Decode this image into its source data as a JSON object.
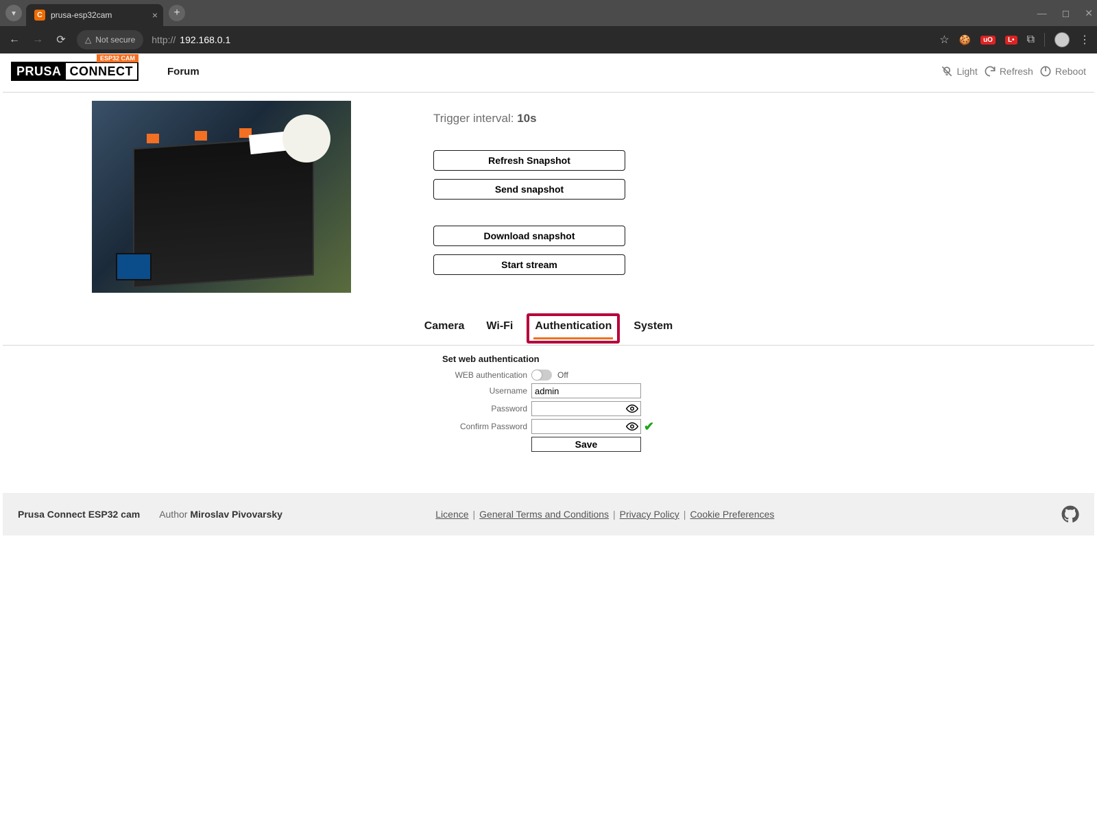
{
  "browser": {
    "tab_title": "prusa-esp32cam",
    "not_secure": "Not secure",
    "url_prefix": "http://",
    "url_ip": "192.168.0.1"
  },
  "header": {
    "logo_prusa": "PRUSA",
    "logo_connect": "CONNECT",
    "logo_tag": "ESP32 CAM",
    "forum": "Forum",
    "light": "Light",
    "refresh": "Refresh",
    "reboot": "Reboot"
  },
  "snapshot": {
    "trigger_label": "Trigger interval: ",
    "trigger_value": "10s",
    "refresh_btn": "Refresh Snapshot",
    "send_btn": "Send snapshot",
    "download_btn": "Download snapshot",
    "stream_btn": "Start stream"
  },
  "tabs": {
    "camera": "Camera",
    "wifi": "Wi-Fi",
    "auth": "Authentication",
    "system": "System"
  },
  "auth_form": {
    "title": "Set web authentication",
    "web_auth_label": "WEB authentication",
    "switch_state": "Off",
    "username_label": "Username",
    "username_value": "admin",
    "password_label": "Password",
    "confirm_label": "Confirm Password",
    "save": "Save"
  },
  "footer": {
    "title": "Prusa Connect ESP32 cam",
    "author_prefix": "Author ",
    "author_name": "Miroslav Pivovarsky",
    "licence": "Licence",
    "terms": "General Terms and Conditions",
    "privacy": "Privacy Policy",
    "cookies": "Cookie Preferences"
  }
}
